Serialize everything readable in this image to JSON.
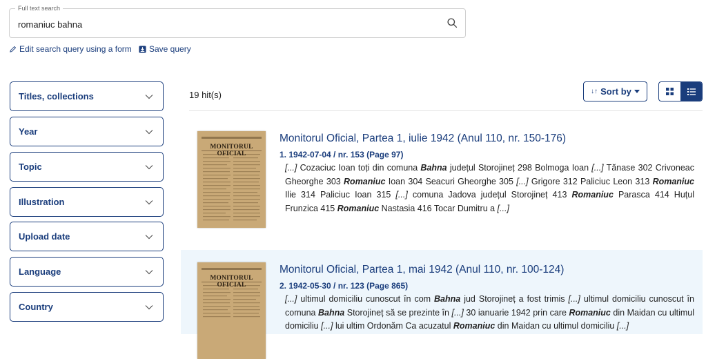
{
  "search": {
    "legend": "Full text search",
    "value": "romaniuc bahna",
    "icon": "search-icon"
  },
  "links": {
    "edit": "Edit search query using a form",
    "save": "Save query"
  },
  "facets": [
    {
      "label": "Titles, collections"
    },
    {
      "label": "Year"
    },
    {
      "label": "Topic"
    },
    {
      "label": "Illustration"
    },
    {
      "label": "Upload date"
    },
    {
      "label": "Language"
    },
    {
      "label": "Country"
    }
  ],
  "results_header": {
    "hits": "19 hit(s)",
    "sort_label": "Sort by",
    "sort_icon": "sort-icon",
    "grid_icon": "grid-view-icon",
    "list_icon": "list-view-icon"
  },
  "colors": {
    "primary": "#1a3d7c",
    "highlight_row": "#eef6fc"
  },
  "results": [
    {
      "title": "Monitorul Oficial, Partea 1, iulie 1942 (Anul 110, nr. 150-176)",
      "hit": "1. 1942-07-04 / nr. 153 (Page 97)",
      "thumb_text": "MONITORUL OFICIAL",
      "snippet": [
        {
          "t": "[...]",
          "s": "i"
        },
        {
          "t": " Cozaciuc Ioan toți din comuna ",
          "s": ""
        },
        {
          "t": "Bahna",
          "s": "b"
        },
        {
          "t": " județul Storojineț 298 Bolmoga Ioan ",
          "s": ""
        },
        {
          "t": "[...]",
          "s": "i"
        },
        {
          "t": " Tănase 302 Crivoneac Gheorghe 303 ",
          "s": ""
        },
        {
          "t": "Romaniuc",
          "s": "b"
        },
        {
          "t": " Ioan 304 Seacuri Gheorghe 305 ",
          "s": ""
        },
        {
          "t": "[...]",
          "s": "i"
        },
        {
          "t": " Grigore 312 Paliciuc Leon 313 ",
          "s": ""
        },
        {
          "t": "Romaniuc",
          "s": "b"
        },
        {
          "t": " Ilie 314 Paliciuc Ioan 315 ",
          "s": ""
        },
        {
          "t": "[...]",
          "s": "i"
        },
        {
          "t": " comuna Jadova județul Storojineț 413 ",
          "s": ""
        },
        {
          "t": "Romaniuc",
          "s": "b"
        },
        {
          "t": " Parasca 414 Huțul Frunzica 415 ",
          "s": ""
        },
        {
          "t": "Romaniuc",
          "s": "b"
        },
        {
          "t": " Nastasia 416 Tocar Dumitru a ",
          "s": ""
        },
        {
          "t": "[...]",
          "s": "i"
        }
      ]
    },
    {
      "title": "Monitorul Oficial, Partea 1, mai 1942 (Anul 110, nr. 100-124)",
      "hit": "2. 1942-05-30 / nr. 123 (Page 865)",
      "thumb_text": "MONITORUL OFICIAL",
      "snippet": [
        {
          "t": "[...]",
          "s": "i"
        },
        {
          "t": " ultimul domiciliu cunoscut în com ",
          "s": ""
        },
        {
          "t": "Bahna",
          "s": "b"
        },
        {
          "t": " jud Storojineț a fost trimis ",
          "s": ""
        },
        {
          "t": "[...]",
          "s": "i"
        },
        {
          "t": " ultimul domiciliu cunoscut în comuna ",
          "s": ""
        },
        {
          "t": "Bahna",
          "s": "b"
        },
        {
          "t": " Storojineț să se prezinte în ",
          "s": ""
        },
        {
          "t": "[...]",
          "s": "i"
        },
        {
          "t": " 30 ianuarie 1942 prin care ",
          "s": ""
        },
        {
          "t": "Romaniuc",
          "s": "b"
        },
        {
          "t": " din Maidan cu ultimul domiciliu ",
          "s": ""
        },
        {
          "t": "[...]",
          "s": "i"
        },
        {
          "t": " lui ultim Ordonăm Ca acuzatul ",
          "s": ""
        },
        {
          "t": "Romaniuc",
          "s": "b"
        },
        {
          "t": " din Maidan cu ultimul domiciliu ",
          "s": ""
        },
        {
          "t": "[...]",
          "s": "i"
        }
      ]
    }
  ]
}
